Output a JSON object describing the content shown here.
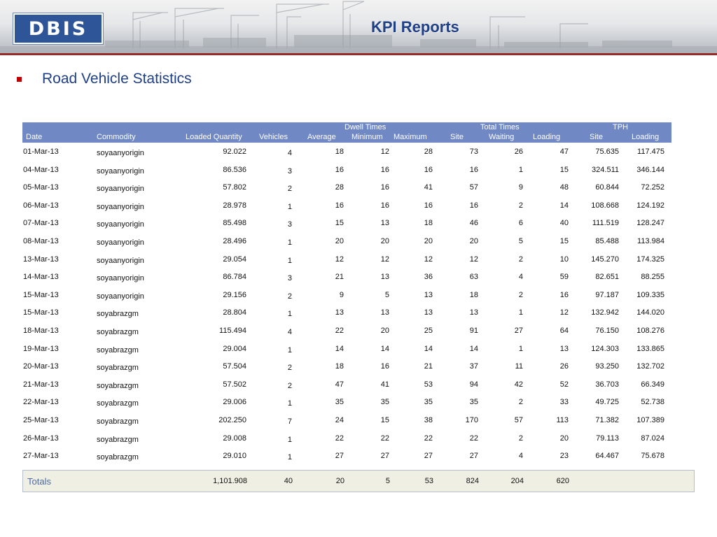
{
  "header": {
    "logo_text": "DBIS",
    "title": "KPI Reports",
    "rule_color": "#9a2a2a"
  },
  "bullet": {
    "text": "Road Vehicle Statistics"
  },
  "table": {
    "group_headers": {
      "dwell": "Dwell Times",
      "total": "Total Times",
      "tph": "TPH"
    },
    "columns": [
      "Date",
      "Commodity",
      "Loaded Quantity",
      "Vehicles",
      "Average",
      "Minimum",
      "Maximum",
      "Site",
      "Waiting",
      "Loading",
      "Site",
      "Loading"
    ],
    "rows": [
      [
        "01-Mar-13",
        "soyaanyorigin",
        "92.022",
        "4",
        "18",
        "12",
        "28",
        "73",
        "26",
        "47",
        "75.635",
        "117.475"
      ],
      [
        "04-Mar-13",
        "soyaanyorigin",
        "86.536",
        "3",
        "16",
        "16",
        "16",
        "16",
        "1",
        "15",
        "324.511",
        "346.144"
      ],
      [
        "05-Mar-13",
        "soyaanyorigin",
        "57.802",
        "2",
        "28",
        "16",
        "41",
        "57",
        "9",
        "48",
        "60.844",
        "72.252"
      ],
      [
        "06-Mar-13",
        "soyaanyorigin",
        "28.978",
        "1",
        "16",
        "16",
        "16",
        "16",
        "2",
        "14",
        "108.668",
        "124.192"
      ],
      [
        "07-Mar-13",
        "soyaanyorigin",
        "85.498",
        "3",
        "15",
        "13",
        "18",
        "46",
        "6",
        "40",
        "111.519",
        "128.247"
      ],
      [
        "08-Mar-13",
        "soyaanyorigin",
        "28.496",
        "1",
        "20",
        "20",
        "20",
        "20",
        "5",
        "15",
        "85.488",
        "113.984"
      ],
      [
        "13-Mar-13",
        "soyaanyorigin",
        "29.054",
        "1",
        "12",
        "12",
        "12",
        "12",
        "2",
        "10",
        "145.270",
        "174.325"
      ],
      [
        "14-Mar-13",
        "soyaanyorigin",
        "86.784",
        "3",
        "21",
        "13",
        "36",
        "63",
        "4",
        "59",
        "82.651",
        "88.255"
      ],
      [
        "15-Mar-13",
        "soyaanyorigin",
        "29.156",
        "2",
        "9",
        "5",
        "13",
        "18",
        "2",
        "16",
        "97.187",
        "109.335"
      ],
      [
        "15-Mar-13",
        "soyabrazgm",
        "28.804",
        "1",
        "13",
        "13",
        "13",
        "13",
        "1",
        "12",
        "132.942",
        "144.020"
      ],
      [
        "18-Mar-13",
        "soyabrazgm",
        "115.494",
        "4",
        "22",
        "20",
        "25",
        "91",
        "27",
        "64",
        "76.150",
        "108.276"
      ],
      [
        "19-Mar-13",
        "soyabrazgm",
        "29.004",
        "1",
        "14",
        "14",
        "14",
        "14",
        "1",
        "13",
        "124.303",
        "133.865"
      ],
      [
        "20-Mar-13",
        "soyabrazgm",
        "57.504",
        "2",
        "18",
        "16",
        "21",
        "37",
        "11",
        "26",
        "93.250",
        "132.702"
      ],
      [
        "21-Mar-13",
        "soyabrazgm",
        "57.502",
        "2",
        "47",
        "41",
        "53",
        "94",
        "42",
        "52",
        "36.703",
        "66.349"
      ],
      [
        "22-Mar-13",
        "soyabrazgm",
        "29.006",
        "1",
        "35",
        "35",
        "35",
        "35",
        "2",
        "33",
        "49.725",
        "52.738"
      ],
      [
        "25-Mar-13",
        "soyabrazgm",
        "202.250",
        "7",
        "24",
        "15",
        "38",
        "170",
        "57",
        "113",
        "71.382",
        "107.389"
      ],
      [
        "26-Mar-13",
        "soyabrazgm",
        "29.008",
        "1",
        "22",
        "22",
        "22",
        "22",
        "2",
        "20",
        "79.113",
        "87.024"
      ],
      [
        "27-Mar-13",
        "soyabrazgm",
        "29.010",
        "1",
        "27",
        "27",
        "27",
        "27",
        "4",
        "23",
        "64.467",
        "75.678"
      ]
    ],
    "totals": {
      "label": "Totals",
      "loaded_quantity": "1,101.908",
      "vehicles": "40",
      "average": "20",
      "minimum": "5",
      "maximum": "53",
      "site": "824",
      "waiting": "204",
      "loading": "620"
    },
    "header_color": "#7088c4",
    "totals_color": "#efefe3"
  }
}
